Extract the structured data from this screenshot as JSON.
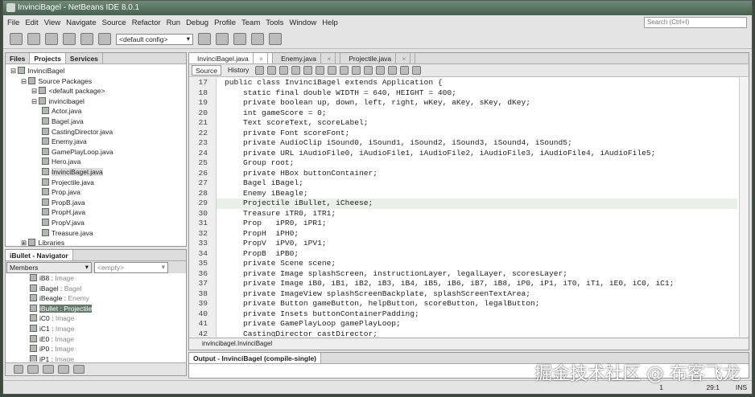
{
  "title": "InvinciBagel - NetBeans IDE 8.0.1",
  "search_placeholder": "Search (Ctrl+I)",
  "menu": [
    "File",
    "Edit",
    "View",
    "Navigate",
    "Source",
    "Refactor",
    "Run",
    "Debug",
    "Profile",
    "Team",
    "Tools",
    "Window",
    "Help"
  ],
  "config": "<default config>",
  "left_tabs": [
    "Files",
    "Projects",
    "Services"
  ],
  "tree": [
    {
      "label": "InvinciBagel",
      "depth": 0
    },
    {
      "label": "Source Packages",
      "depth": 1
    },
    {
      "label": "<default package>",
      "depth": 2
    },
    {
      "label": "invincibagel",
      "depth": 2
    },
    {
      "label": "Actor.java",
      "depth": 3
    },
    {
      "label": "Bagel.java",
      "depth": 3
    },
    {
      "label": "CastingDirector.java",
      "depth": 3
    },
    {
      "label": "Enemy.java",
      "depth": 3
    },
    {
      "label": "GamePlayLoop.java",
      "depth": 3
    },
    {
      "label": "Hero.java",
      "depth": 3
    },
    {
      "label": "InvinciBagel.java",
      "depth": 3
    },
    {
      "label": "Projectile.java",
      "depth": 3
    },
    {
      "label": "Prop.java",
      "depth": 3
    },
    {
      "label": "PropB.java",
      "depth": 3
    },
    {
      "label": "PropH.java",
      "depth": 3
    },
    {
      "label": "PropV.java",
      "depth": 3
    },
    {
      "label": "Treasure.java",
      "depth": 3
    },
    {
      "label": "Libraries",
      "depth": 1
    }
  ],
  "navigator": {
    "title": "iBullet - Navigator",
    "filter": "Members",
    "filter2": "<empty>",
    "items": [
      [
        "iB8",
        "Image"
      ],
      [
        "iBagel",
        "Bagel"
      ],
      [
        "iBeagle",
        "Enemy"
      ],
      [
        "iBullet",
        "Projectile"
      ],
      [
        "iC0",
        "Image"
      ],
      [
        "iC1",
        "Image"
      ],
      [
        "iE0",
        "Image"
      ],
      [
        "iP0",
        "Image"
      ],
      [
        "iP1",
        "Image"
      ]
    ]
  },
  "editor_tabs": [
    "InvinciBagel.java",
    "Enemy.java",
    "Projectile.java"
  ],
  "editor_modes": [
    "Source",
    "History"
  ],
  "code": [
    [
      "17",
      "public class InvinciBagel extends Application {"
    ],
    [
      "18",
      "    static final double WIDTH = 640, HEIGHT = 400;"
    ],
    [
      "19",
      "    private boolean up, down, left, right, wKey, aKey, sKey, dKey;"
    ],
    [
      "20",
      "    int gameScore = 0;"
    ],
    [
      "21",
      "    Text scoreText, scoreLabel;"
    ],
    [
      "22",
      "    private Font scoreFont;"
    ],
    [
      "23",
      "    private AudioClip iSound0, iSound1, iSound2, iSound3, iSound4, iSound5;"
    ],
    [
      "24",
      "    private URL iAudioFile0, iAudioFile1, iAudioFile2, iAudioFile3, iAudioFile4, iAudioFile5;"
    ],
    [
      "25",
      "    Group root;"
    ],
    [
      "26",
      "    private HBox buttonContainer;"
    ],
    [
      "27",
      "    Bagel iBagel;"
    ],
    [
      "28",
      "    Enemy iBeagle;"
    ],
    [
      "29",
      "    Projectile iBullet, iCheese;"
    ],
    [
      "30",
      "    Treasure iTR0, iTR1;"
    ],
    [
      "31",
      "    Prop   iPR0, iPR1;"
    ],
    [
      "32",
      "    PropH  iPH0;"
    ],
    [
      "33",
      "    PropV  iPV0, iPV1;"
    ],
    [
      "34",
      "    PropB  iPB0;"
    ],
    [
      "35",
      "    private Scene scene;"
    ],
    [
      "36",
      "    private Image splashScreen, instructionLayer, legalLayer, scoresLayer;"
    ],
    [
      "37",
      "    private Image iB0, iB1, iB2, iB3, iB4, iB5, iB6, iB7, iB8, iP0, iP1, iT0, iT1, iE0, iC0, iC1;"
    ],
    [
      "38",
      "    private ImageView splashScreenBackplate, splashScreenTextArea;"
    ],
    [
      "39",
      "    private Button gameButton, helpButton, scoreButton, legalButton;"
    ],
    [
      "40",
      "    private Insets buttonContainerPadding;"
    ],
    [
      "41",
      "    private GamePlayLoop gamePlayLoop;"
    ],
    [
      "42",
      "    CastingDirector castDirector;"
    ]
  ],
  "breadcrumb": "invincibagel.InvinciBagel",
  "output_title": "Output - InvinciBagel (compile-single)",
  "status": {
    "notifications": "1",
    "position": "29:1",
    "mode": "INS"
  },
  "watermark": "掘金技术社区 @ 布客飞龙"
}
